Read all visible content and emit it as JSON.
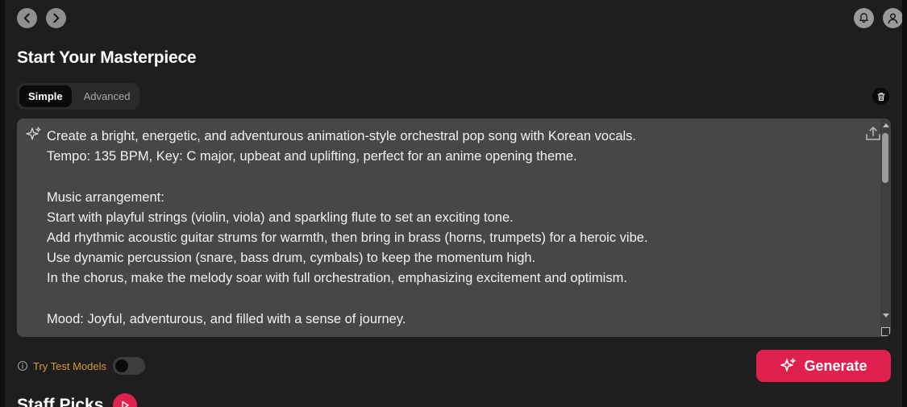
{
  "header": {
    "back_icon": "chevron-left-icon",
    "forward_icon": "chevron-right-icon",
    "notifications_icon": "bell-icon",
    "profile_icon": "user-icon"
  },
  "page": {
    "title": "Start Your Masterpiece"
  },
  "tabs": [
    {
      "label": "Simple",
      "active": true
    },
    {
      "label": "Advanced",
      "active": false
    }
  ],
  "prompt": {
    "lines": [
      "Create a bright, energetic, and adventurous animation-style orchestral pop song with Korean vocals.",
      "Tempo: 135 BPM, Key: C major, upbeat and uplifting, perfect for an anime opening theme.",
      "",
      "Music arrangement:",
      "Start with playful strings (violin, viola) and sparkling flute to set an exciting tone.",
      "Add rhythmic acoustic guitar strums for warmth, then bring in brass (horns, trumpets) for a heroic vibe.",
      "Use dynamic percussion (snare, bass drum, cymbals) to keep the momentum high.",
      "In the chorus, make the melody soar with full orchestration, emphasizing excitement and optimism.",
      "",
      "Mood: Joyful, adventurous, and filled with a sense of journey."
    ]
  },
  "controls": {
    "test_models_label": "Try Test Models",
    "test_models_enabled": false,
    "generate_label": "Generate"
  },
  "section": {
    "staff_picks_title": "Staff Picks"
  },
  "colors": {
    "accent": "#e0214e",
    "warning_label": "#d59a2e",
    "panel_bg": "#1e1e1e",
    "prompt_bg": "#474747"
  }
}
